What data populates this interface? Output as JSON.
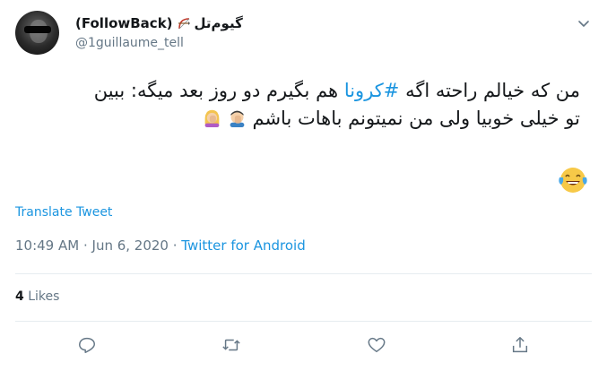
{
  "user": {
    "display_name": "(FollowBack)",
    "display_name_fa": "گیوم‌تل",
    "handle": "@1guillaume_tell",
    "avatar_icon": "sunglasses-avatar",
    "name_icon": "bow-and-arrow-icon"
  },
  "tweet": {
    "line1_pre": "من که خیالم راحته اگه ",
    "hashtag": "#کرونا",
    "line1_post": " هم بگیرم دو روز بعد میگه: ببین",
    "line2": "تو خیلی خوبیا ولی من نمیتونم باهات باشم",
    "line2_emojis": [
      "man-facepalming-emoji",
      "woman-facepalming-emoji"
    ],
    "trailing_emoji": "face-with-tears-of-joy-emoji"
  },
  "translate_label": "Translate Tweet",
  "meta": {
    "time": "10:49 AM",
    "separator": " · ",
    "date": "Jun 6, 2020",
    "source": "Twitter for Android"
  },
  "stats": {
    "likes_count": "4",
    "likes_label": " Likes"
  },
  "actions": [
    "reply-icon",
    "retweet-icon",
    "like-icon",
    "share-icon"
  ],
  "colors": {
    "link": "#1b95e0",
    "secondary": "#657786",
    "divider": "#e6ecf0"
  }
}
